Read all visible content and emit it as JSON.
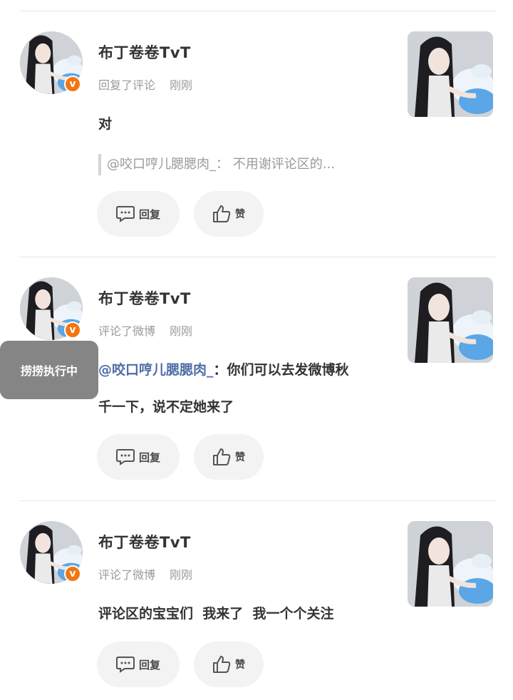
{
  "comments": [
    {
      "user": "布丁卷卷TvT",
      "action": "回复了评论",
      "time": "刚刚",
      "text": "对",
      "quote": "@咬口哼儿腮腮肉_：  不用谢评论区的...",
      "reply_label": "回复",
      "like_label": "赞",
      "badge": "v"
    },
    {
      "user": "布丁卷卷TvT",
      "action": "评论了微博",
      "time": "刚刚",
      "mention": "@咬口哼儿腮腮肉_",
      "text_line1": "：你们可以去发微博秋",
      "text_line2": "千一下，说不定她来了",
      "reply_label": "回复",
      "like_label": "赞",
      "badge": "v"
    },
    {
      "user": "布丁卷卷TvT",
      "action": "评论了微博",
      "time": "刚刚",
      "text": "评论区的宝宝们  我来了  我一个个关注",
      "reply_label": "回复",
      "like_label": "赞",
      "badge": "v"
    }
  ],
  "toast": {
    "text": "捞捞执行中"
  },
  "icons": {
    "reply": "comment-bubble-icon",
    "like": "thumbs-up-icon",
    "badge": "verified-v-icon"
  },
  "colors": {
    "badge": "#f3750f",
    "mention": "#4f6ea6",
    "button_bg": "#f3f3f3"
  }
}
